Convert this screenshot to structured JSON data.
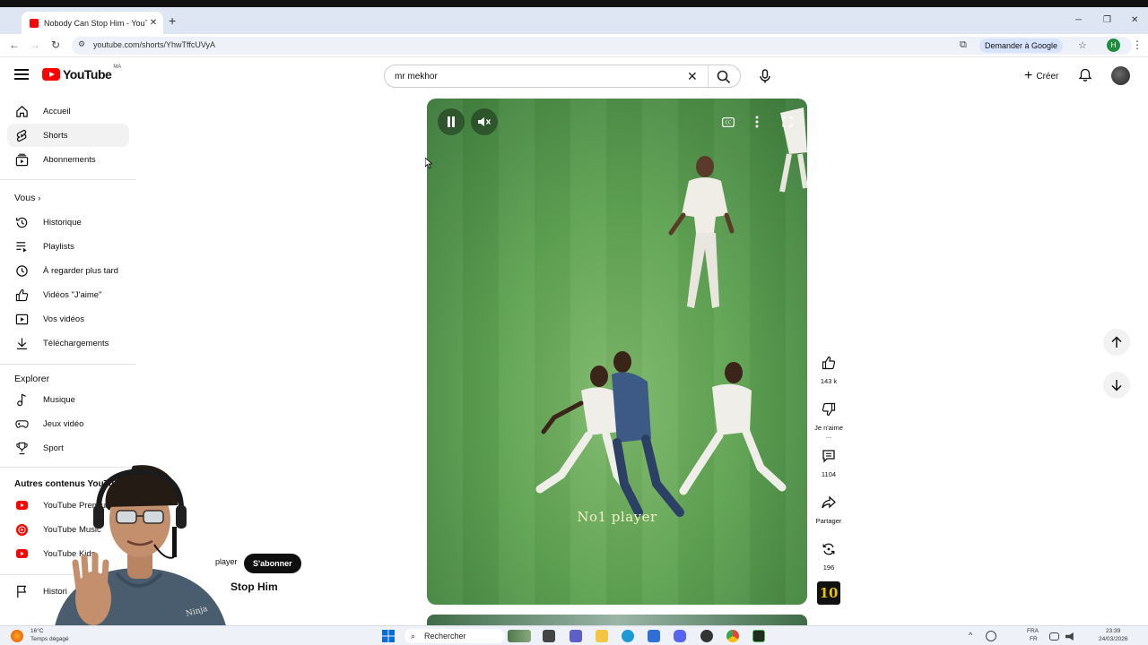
{
  "browser": {
    "tab_title": "Nobody Can Stop Him - YouTube",
    "url": "youtube.com/shorts/YhwTffcUVyA",
    "ask_google": "Demander à Google",
    "profile_initial": "H"
  },
  "masthead": {
    "logo_text": "YouTube",
    "country_code": "MA",
    "search_query": "mr mekhor",
    "create_label": "Créer"
  },
  "sidebar": {
    "main": [
      {
        "label": "Accueil",
        "icon": "home-icon"
      },
      {
        "label": "Shorts",
        "icon": "shorts-icon",
        "active": true
      },
      {
        "label": "Abonnements",
        "icon": "subscriptions-icon"
      }
    ],
    "you_header": "Vous",
    "you": [
      {
        "label": "Historique",
        "icon": "history-icon"
      },
      {
        "label": "Playlists",
        "icon": "playlist-icon"
      },
      {
        "label": "À regarder plus tard",
        "icon": "clock-icon"
      },
      {
        "label": "Vidéos \"J'aime\"",
        "icon": "thumbs-up-icon"
      },
      {
        "label": "Vos vidéos",
        "icon": "video-icon"
      },
      {
        "label": "Téléchargements",
        "icon": "download-icon"
      }
    ],
    "explore_header": "Explorer",
    "explore": [
      {
        "label": "Musique",
        "icon": "music-icon"
      },
      {
        "label": "Jeux vidéo",
        "icon": "gaming-icon"
      },
      {
        "label": "Sport",
        "icon": "trophy-icon"
      }
    ],
    "more_header": "Autres contenus YouTub",
    "more": [
      {
        "label": "YouTube Premium"
      },
      {
        "label": "YouTube Music"
      },
      {
        "label": "YouTube Kids"
      }
    ],
    "report_label": "Histori"
  },
  "short": {
    "caption": "No1 player",
    "channel_fragment": "player",
    "subscribe_label": "S'abonner",
    "title_fragment": "Stop Him",
    "likes": "143 k",
    "dislike_label": "Je n'aime ...",
    "comments": "1104",
    "share_label": "Partager",
    "remix_count": "196",
    "next_thumb_text": "10"
  },
  "taskbar": {
    "weather_temp": "16°C",
    "weather_desc": "Temps dégagé",
    "search_placeholder": "Rechercher",
    "lang_top": "FRA",
    "lang_bottom": "FR",
    "time": "23:39",
    "date": "24/03/2026"
  }
}
